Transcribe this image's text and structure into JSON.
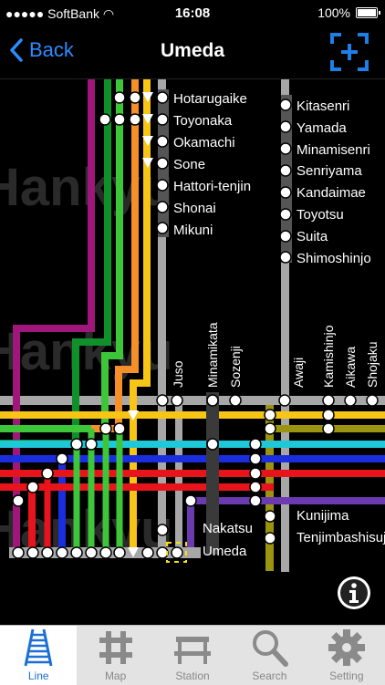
{
  "status": {
    "carrier": "SoftBank",
    "time": "16:08",
    "battery": "100%"
  },
  "nav": {
    "back_label": "Back",
    "title": "Umeda"
  },
  "stations_top_left": [
    "Hotarugaike",
    "Toyonaka",
    "Okamachi",
    "Sone",
    "Hattori-tenjin",
    "Shonai",
    "Mikuni"
  ],
  "stations_top_right": [
    "Kitasenri",
    "Yamada",
    "Minamisenri",
    "Senriyama",
    "Kandaimae",
    "Toyotsu",
    "Suita",
    "Shimoshinjo"
  ],
  "stations_vertical": [
    "Juso",
    "Minamikata",
    "Sozenji",
    "Awaji",
    "Kamishinjo",
    "Aikawa",
    "Shojaku"
  ],
  "stations_bottom": [
    "Nakatsu",
    "Umeda",
    "Kunijima",
    "Tenjimbashisuji"
  ],
  "watermark": "Hankyu",
  "line_colors": {
    "magenta": "#a0167a",
    "red": "#e8141c",
    "darkgreen": "#10902a",
    "green": "#3ec63a",
    "orange": "#f58f2a",
    "yellow": "#f7c515",
    "gray": "#a7a7a7",
    "blue": "#1a2ee0",
    "cyan": "#1ec8d8",
    "purple": "#6b3ab0",
    "olive": "#9a9410"
  },
  "tabs": [
    {
      "label": "Line",
      "icon": "track-icon",
      "active": true
    },
    {
      "label": "Map",
      "icon": "map-grid-icon",
      "active": false
    },
    {
      "label": "Station",
      "icon": "station-bench-icon",
      "active": false
    },
    {
      "label": "Search",
      "icon": "search-icon",
      "active": false
    },
    {
      "label": "Setting",
      "icon": "gear-icon",
      "active": false
    }
  ]
}
